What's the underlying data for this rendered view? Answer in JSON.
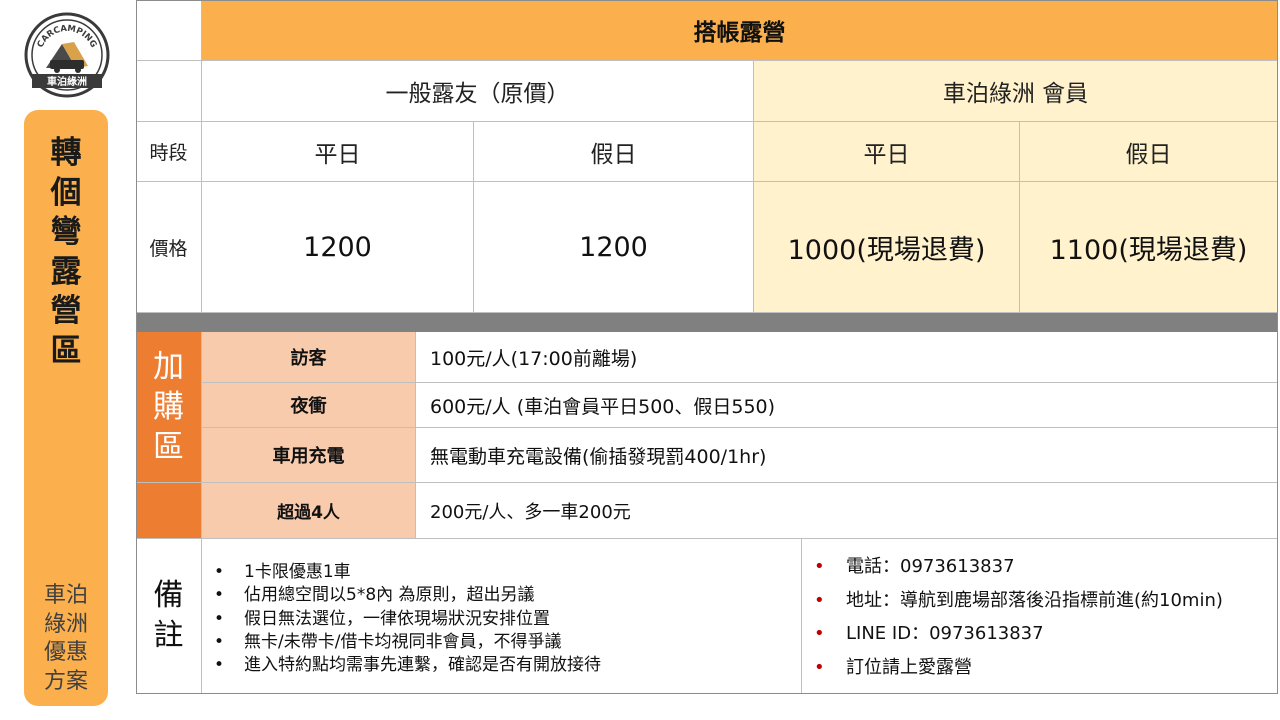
{
  "logo": {
    "top_text": "CARCAMPING",
    "bottom_text": "車泊綠洲"
  },
  "sidebar": {
    "title_chars": [
      "轉",
      "個",
      "彎",
      "露",
      "營",
      "區"
    ],
    "subtitle_lines": [
      "車泊",
      "綠洲",
      "優惠",
      "方案"
    ]
  },
  "table": {
    "title": "搭帳露營",
    "group_general": "一般露友（原價）",
    "group_member": "車泊綠洲 會員",
    "row_period_label": "時段",
    "row_price_label": "價格",
    "periods": [
      "平日",
      "假日",
      "平日",
      "假日"
    ],
    "prices": [
      "1200",
      "1200",
      "1000(現場退費)",
      "1100(現場退費)"
    ]
  },
  "addons": {
    "section_label_chars": [
      "加",
      "購",
      "區"
    ],
    "items": [
      {
        "name": "訪客",
        "desc": "100元/人(17:00前離場)"
      },
      {
        "name": "夜衝",
        "desc": "600元/人  (車泊會員平日500、假日550)"
      },
      {
        "name": "車用充電",
        "desc": "無電動車充電設備(偷插發現罰400/1hr)"
      },
      {
        "name": "超過4人",
        "desc": "200元/人、多一車200元"
      }
    ]
  },
  "notes": {
    "label_chars": [
      "備",
      "註"
    ],
    "left": [
      "1卡限優惠1車",
      "佔用總空間以5*8內 為原則，超出另議",
      "假日無法選位，一律依現場狀況安排位置",
      "無卡/未帶卡/借卡均視同非會員，不得爭議",
      "進入特約點均需事先連繫，確認是否有開放接待"
    ],
    "right": [
      "電話：0973613837",
      "地址：導航到鹿場部落後沿指標前進(約10min)",
      "LINE ID：0973613837",
      "訂位請上愛露營"
    ]
  },
  "colors": {
    "orange": "#fbb04d",
    "dark_orange": "#ed7d31",
    "peach": "#f8cbad",
    "cream": "#fff2cc",
    "bullet_red": "#c00000"
  }
}
